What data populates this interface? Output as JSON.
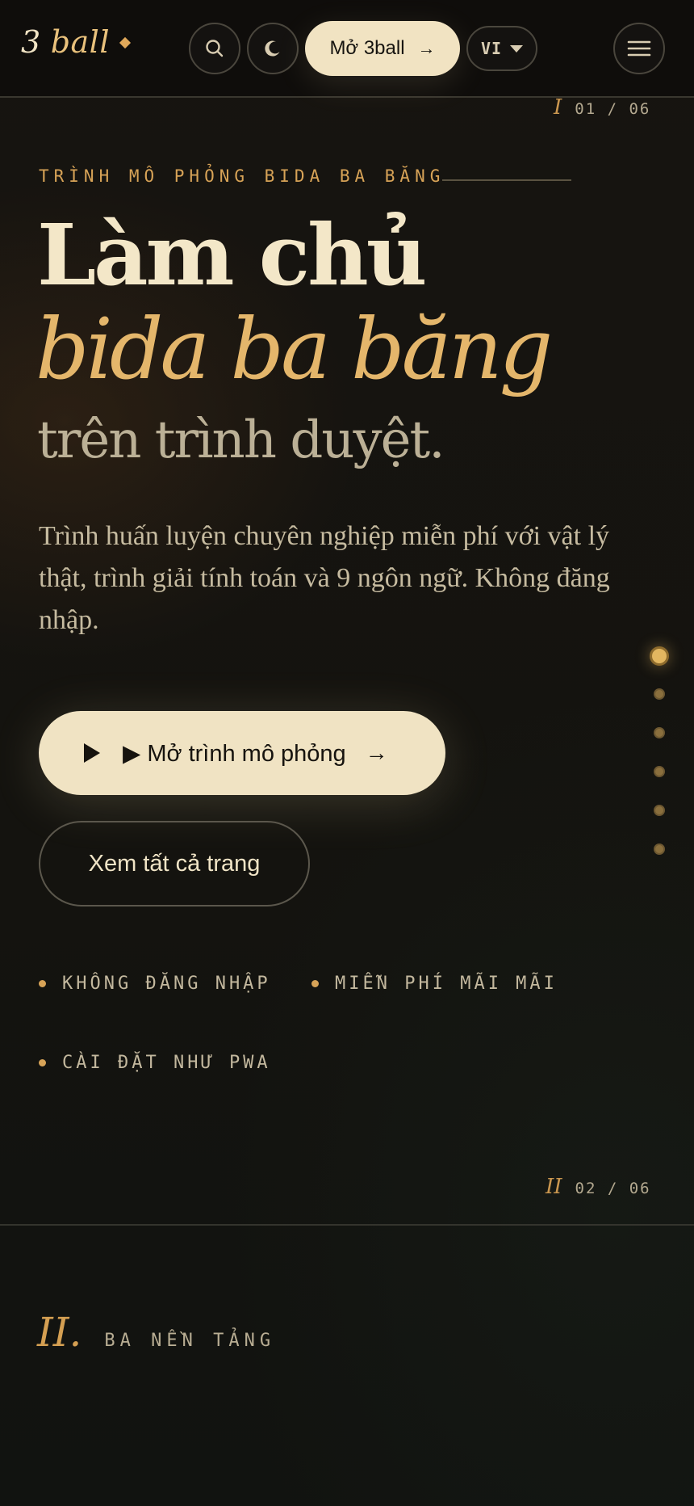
{
  "header": {
    "logo_num": "3",
    "logo_word": "ball",
    "open_label": "Mở 3ball",
    "open_arrow": "→",
    "lang": "VI",
    "icons": [
      "search-icon",
      "moon-icon",
      "menu-icon"
    ]
  },
  "section1": {
    "roman": "I",
    "counter": "01 / 06",
    "eyebrow": "TRÌNH MÔ PHỎNG BIDA BA BĂNG",
    "headline_line1": "Làm chủ",
    "headline_line2": "bida ba băng",
    "headline_line3": "trên trình duyệt.",
    "lead": "Trình huấn luyện chuyên nghiệp miễn phí với vật lý thật, trình giải tính toán và 9 ngôn ngữ. Không đăng nhập.",
    "primary_cta": "▶ Mở trình mô phỏng",
    "primary_arrow": "→",
    "secondary_cta": "Xem tất cả trang",
    "features": [
      "KHÔNG ĐĂNG NHẬP",
      "MIỄN PHÍ MÃI MÃI",
      "CÀI ĐẶT NHƯ PWA"
    ],
    "section_dots": {
      "count": 6,
      "active": 1
    }
  },
  "section2": {
    "roman": "II",
    "counter": "02 / 06",
    "heading_roman": "II.",
    "heading_label": "BA NỀN TẢNG"
  },
  "colors": {
    "background": "#131310",
    "accent_gold": "#e4b66b",
    "cream": "#f0e3c3",
    "muted_text": "#c6bba0"
  }
}
